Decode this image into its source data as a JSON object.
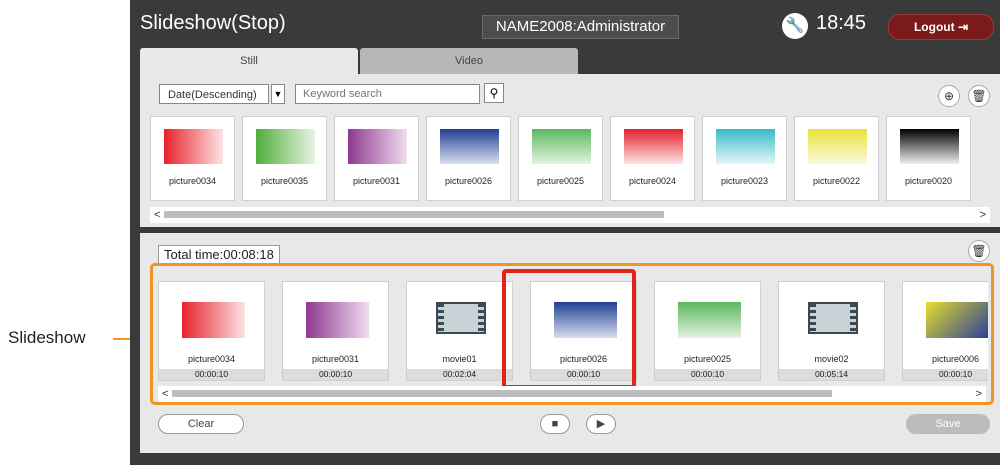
{
  "callout_label": "Slideshow",
  "header": {
    "title": "Slideshow(Stop)",
    "user": "NAME2008:Administrator",
    "time": "18:45",
    "logout_label": "Logout"
  },
  "tabs": [
    {
      "label": "Still"
    },
    {
      "label": "Video"
    }
  ],
  "library": {
    "sort_value": "Date(Descending)",
    "search_placeholder": "Keyword search",
    "items": [
      {
        "label": "picture0034",
        "gradient": "linear-gradient(90deg,#e8212b,#fde3e4)"
      },
      {
        "label": "picture0035",
        "gradient": "linear-gradient(90deg,#4fae3a,#e8f4e3)"
      },
      {
        "label": "picture0031",
        "gradient": "linear-gradient(90deg,#8d3a8f,#f0dcef)"
      },
      {
        "label": "picture0026",
        "gradient": "linear-gradient(180deg,#213f94,#d9def0)"
      },
      {
        "label": "picture0025",
        "gradient": "linear-gradient(180deg,#5bb85d,#e4f3e2)"
      },
      {
        "label": "picture0024",
        "gradient": "linear-gradient(180deg,#e2202b,#fde3e4)"
      },
      {
        "label": "picture0023",
        "gradient": "linear-gradient(180deg,#38bcc9,#e3f6f8)"
      },
      {
        "label": "picture0022",
        "gradient": "linear-gradient(180deg,#e8e23a,#fbf9dd)"
      },
      {
        "label": "picture0020",
        "gradient": "linear-gradient(180deg,#000000,#f0f0f0)"
      }
    ]
  },
  "slideshow": {
    "total_time": "Total time:00:08:18",
    "items": [
      {
        "label": "picture0034",
        "time": "00:00:10",
        "kind": "image",
        "gradient": "linear-gradient(90deg,#e8212b,#fde3e4)"
      },
      {
        "label": "picture0031",
        "time": "00:00:10",
        "kind": "image",
        "gradient": "linear-gradient(90deg,#8d3a8f,#f0dcef)"
      },
      {
        "label": "movie01",
        "time": "00:02:04",
        "kind": "video",
        "gradient": ""
      },
      {
        "label": "picture0026",
        "time": "00:00:10",
        "kind": "image",
        "gradient": "linear-gradient(180deg,#213f94,#d9def0)"
      },
      {
        "label": "picture0025",
        "time": "00:00:10",
        "kind": "image",
        "gradient": "linear-gradient(180deg,#5bb85d,#e4f3e2)"
      },
      {
        "label": "movie02",
        "time": "00:05:14",
        "kind": "video",
        "gradient": ""
      },
      {
        "label": "picture0006",
        "time": "00:00:10",
        "kind": "image",
        "gradient": "linear-gradient(135deg,#e4de2a,#2a3e9a)"
      }
    ],
    "selected_index": 3,
    "clear_label": "Clear",
    "save_label": "Save"
  },
  "colors": {
    "callout": "#f39321",
    "selected": "#e2231a"
  }
}
